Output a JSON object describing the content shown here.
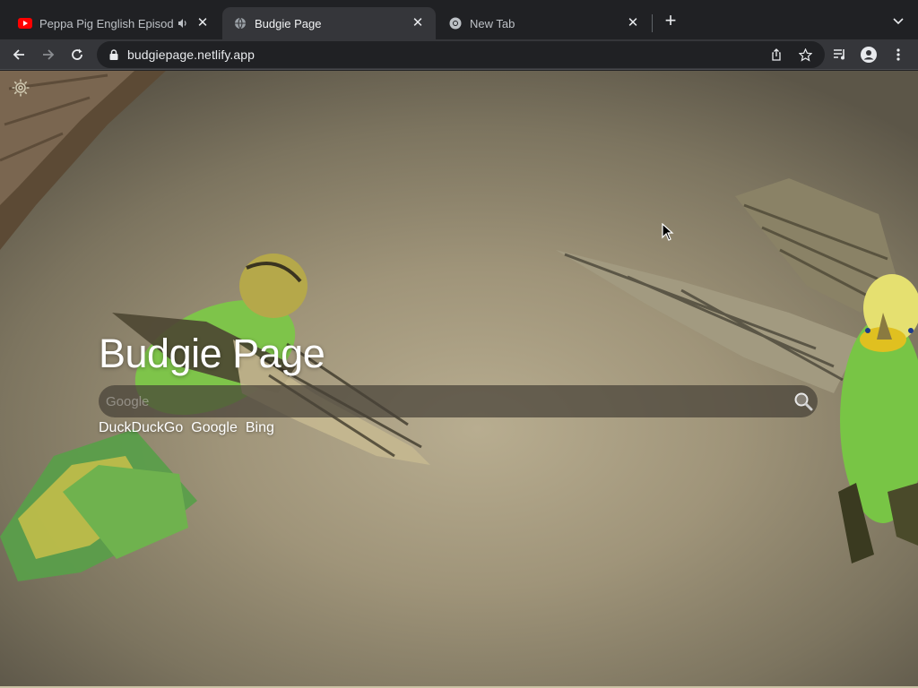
{
  "tabs": [
    {
      "title": "Peppa Pig English Episodes",
      "favicon": "youtube-icon",
      "audio": true,
      "active": false
    },
    {
      "title": "Budgie Page",
      "favicon": "globe-icon",
      "active": true
    },
    {
      "title": "New Tab",
      "favicon": "chrome-icon",
      "active": false
    }
  ],
  "toolbar": {
    "url": "budgiepage.netlify.app"
  },
  "page": {
    "heading": "Budgie Page",
    "search_placeholder": "Google",
    "engines": [
      "DuckDuckGo",
      "Google",
      "Bing"
    ]
  },
  "colors": {
    "tab_strip": "#202124",
    "active_tab": "#35363a",
    "youtube_red": "#ff0000",
    "page_text": "#ffffff"
  }
}
